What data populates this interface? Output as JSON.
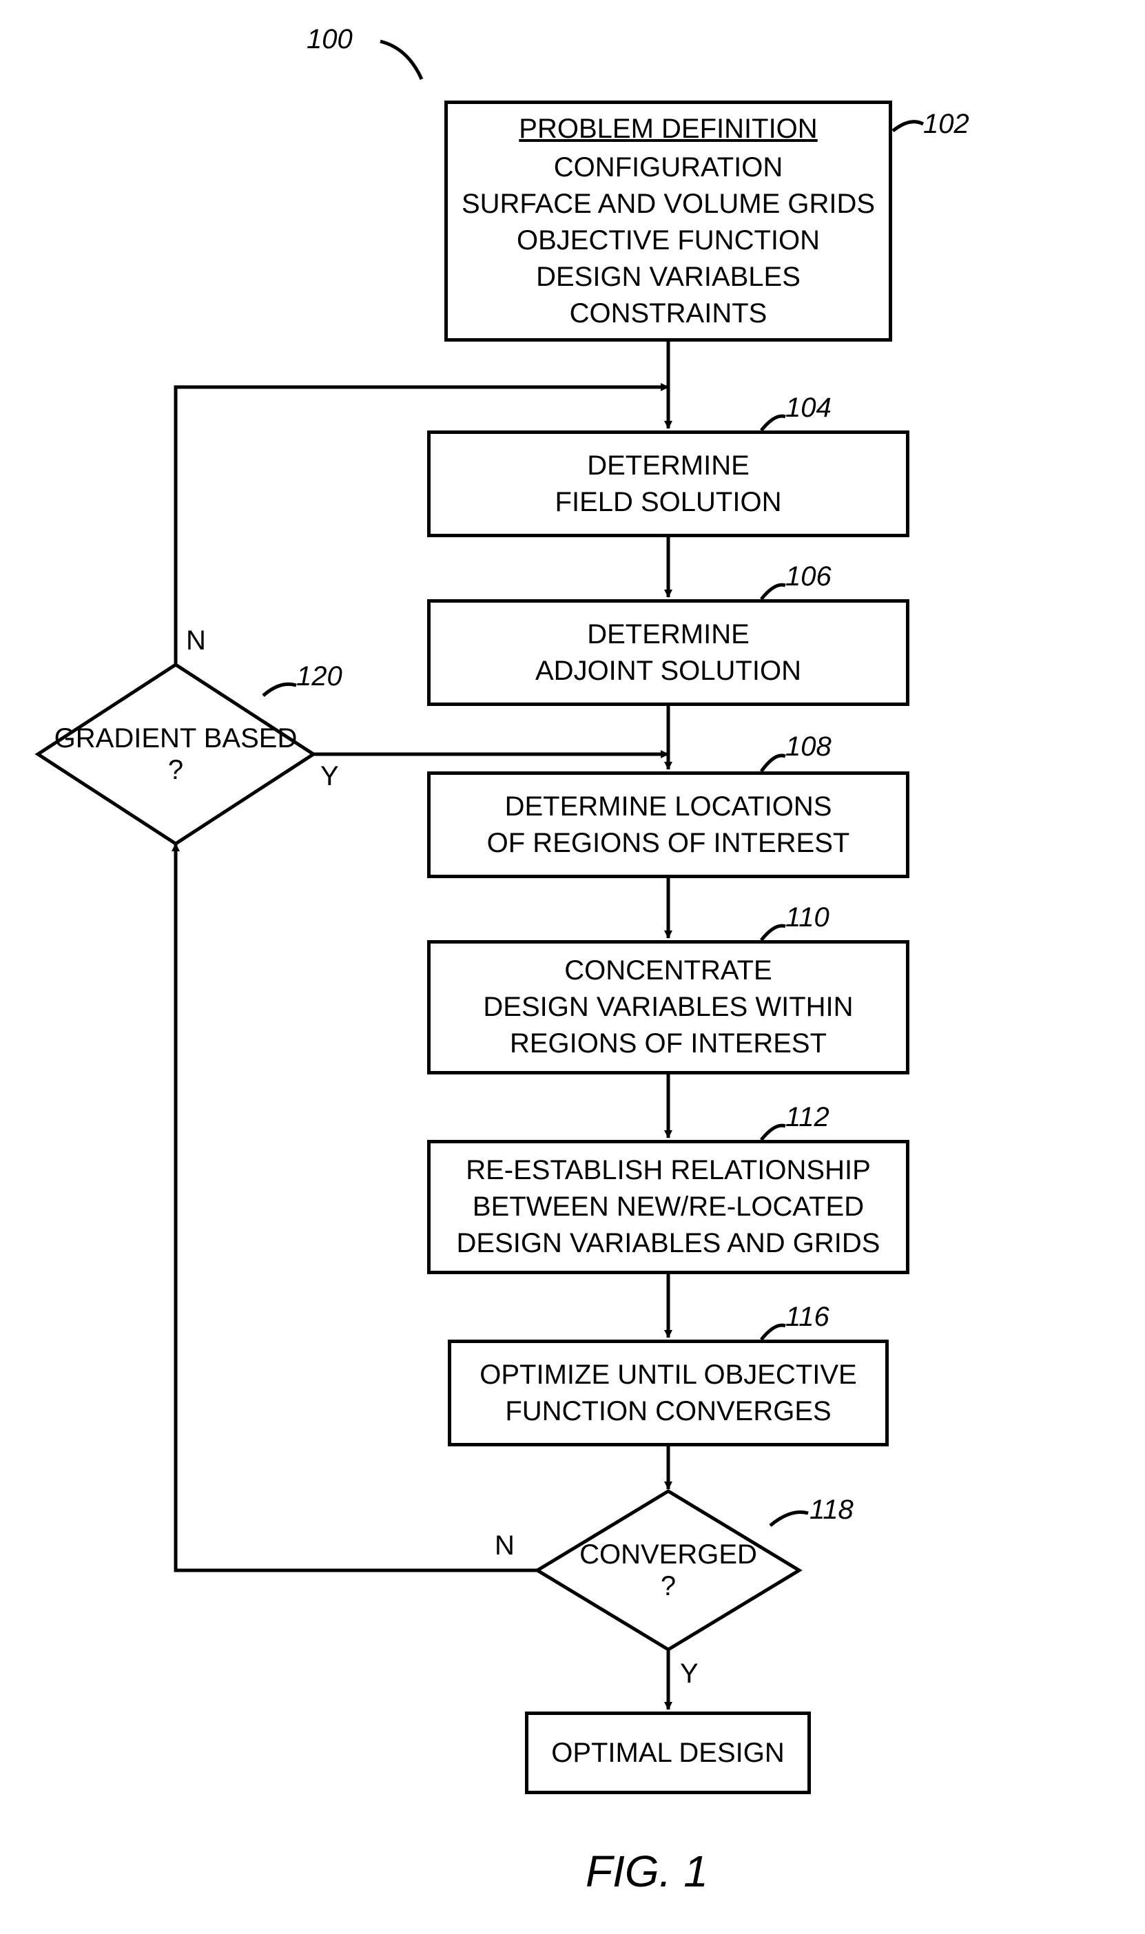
{
  "chart_data": {
    "type": "flowchart",
    "title": "FIG. 1",
    "overall_ref": "100",
    "nodes": [
      {
        "id": "n102",
        "ref": "102",
        "shape": "rect",
        "title": "PROBLEM DEFINITION",
        "body": "CONFIGURATION\nSURFACE AND VOLUME GRIDS\nOBJECTIVE FUNCTION\nDESIGN VARIABLES\nCONSTRAINTS"
      },
      {
        "id": "n104",
        "ref": "104",
        "shape": "rect",
        "body": "DETERMINE\nFIELD SOLUTION"
      },
      {
        "id": "n106",
        "ref": "106",
        "shape": "rect",
        "body": "DETERMINE\nADJOINT SOLUTION"
      },
      {
        "id": "n108",
        "ref": "108",
        "shape": "rect",
        "body": "DETERMINE LOCATIONS\nOF REGIONS OF INTEREST"
      },
      {
        "id": "n110",
        "ref": "110",
        "shape": "rect",
        "body": "CONCENTRATE\nDESIGN VARIABLES WITHIN\nREGIONS OF INTEREST"
      },
      {
        "id": "n112",
        "ref": "112",
        "shape": "rect",
        "body": "RE-ESTABLISH RELATIONSHIP\nBETWEEN NEW/RE-LOCATED\nDESIGN VARIABLES AND GRIDS"
      },
      {
        "id": "n116",
        "ref": "116",
        "shape": "rect",
        "body": "OPTIMIZE UNTIL OBJECTIVE\nFUNCTION CONVERGES"
      },
      {
        "id": "n118",
        "ref": "118",
        "shape": "diamond",
        "body": "CONVERGED\n?"
      },
      {
        "id": "n120",
        "ref": "120",
        "shape": "diamond",
        "body": "GRADIENT BASED\n?"
      },
      {
        "id": "nEnd",
        "shape": "rect",
        "body": "OPTIMAL DESIGN"
      }
    ],
    "edges": [
      {
        "from": "n102",
        "to": "n104"
      },
      {
        "from": "n104",
        "to": "n106"
      },
      {
        "from": "n106",
        "to": "n108"
      },
      {
        "from": "n108",
        "to": "n110"
      },
      {
        "from": "n110",
        "to": "n112"
      },
      {
        "from": "n112",
        "to": "n116"
      },
      {
        "from": "n116",
        "to": "n118"
      },
      {
        "from": "n118",
        "to": "nEnd",
        "label": "Y"
      },
      {
        "from": "n118",
        "to": "n120",
        "label": "N",
        "route": "left-up"
      },
      {
        "from": "n120",
        "to": "n104",
        "label": "N",
        "route": "top-right"
      },
      {
        "from": "n120",
        "to": "n108",
        "label": "Y",
        "route": "right"
      }
    ]
  },
  "labels": {
    "ref100": "100",
    "n102": {
      "ref": "102",
      "title": "PROBLEM DEFINITION",
      "l1": "CONFIGURATION",
      "l2": "SURFACE AND VOLUME GRIDS",
      "l3": "OBJECTIVE FUNCTION",
      "l4": "DESIGN VARIABLES",
      "l5": "CONSTRAINTS"
    },
    "n104": {
      "ref": "104",
      "l1": "DETERMINE",
      "l2": "FIELD SOLUTION"
    },
    "n106": {
      "ref": "106",
      "l1": "DETERMINE",
      "l2": "ADJOINT SOLUTION"
    },
    "n108": {
      "ref": "108",
      "l1": "DETERMINE LOCATIONS",
      "l2": "OF REGIONS OF INTEREST"
    },
    "n110": {
      "ref": "110",
      "l1": "CONCENTRATE",
      "l2": "DESIGN VARIABLES WITHIN",
      "l3": "REGIONS OF INTEREST"
    },
    "n112": {
      "ref": "112",
      "l1": "RE-ESTABLISH RELATIONSHIP",
      "l2": "BETWEEN NEW/RE-LOCATED",
      "l3": "DESIGN VARIABLES AND GRIDS"
    },
    "n116": {
      "ref": "116",
      "l1": "OPTIMIZE UNTIL OBJECTIVE",
      "l2": "FUNCTION CONVERGES"
    },
    "n118": {
      "ref": "118",
      "l1": "CONVERGED",
      "l2": "?"
    },
    "n120": {
      "ref": "120",
      "l1": "GRADIENT BASED",
      "l2": "?"
    },
    "nEnd": {
      "l1": "OPTIMAL DESIGN"
    },
    "yn": {
      "Y": "Y",
      "N": "N"
    },
    "fig": "FIG. 1"
  }
}
